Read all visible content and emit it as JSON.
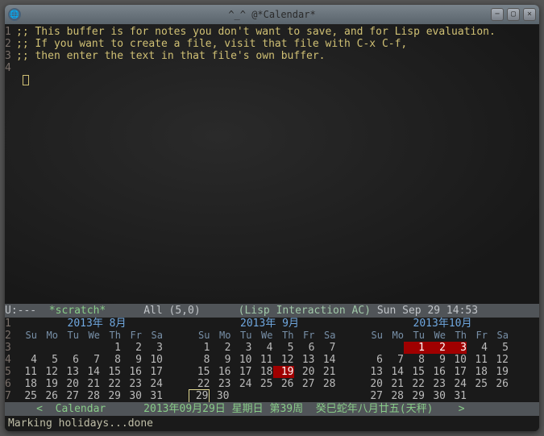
{
  "titlebar": {
    "title": "^_^ @*Calendar*",
    "minimize": "−",
    "maximize": "▢",
    "close": "×"
  },
  "scratch": {
    "lines": [
      ";; This buffer is for notes you don't want to save, and for Lisp evaluation.",
      ";; If you want to create a file, visit that file with C-x C-f,",
      ";; then enter the text in that file's own buffer.",
      ""
    ]
  },
  "modeline_top": {
    "left": "U:---  ",
    "bufname": "*scratch*",
    "mid": "      All (5,0)      ",
    "mode": "(Lisp Interaction AC)",
    "right": " Sun Sep 29 14:53"
  },
  "calendar": {
    "line_start": 1,
    "day_headers": [
      "Su",
      "Mo",
      "Tu",
      "We",
      "Th",
      "Fr",
      "Sa"
    ],
    "months": [
      {
        "title": "2013年 8月",
        "weeks": [
          [
            null,
            null,
            null,
            null,
            1,
            2,
            3
          ],
          [
            4,
            5,
            6,
            7,
            8,
            9,
            10
          ],
          [
            11,
            12,
            13,
            14,
            15,
            16,
            17
          ],
          [
            18,
            19,
            20,
            21,
            22,
            23,
            24
          ],
          [
            25,
            26,
            27,
            28,
            29,
            30,
            31
          ]
        ],
        "holidays": [],
        "today": null,
        "cursor": null
      },
      {
        "title": "2013年 9月",
        "weeks": [
          [
            1,
            2,
            3,
            4,
            5,
            6,
            7
          ],
          [
            8,
            9,
            10,
            11,
            12,
            13,
            14
          ],
          [
            15,
            16,
            17,
            18,
            19,
            20,
            21
          ],
          [
            22,
            23,
            24,
            25,
            26,
            27,
            28
          ],
          [
            29,
            30,
            null,
            null,
            null,
            null,
            null
          ]
        ],
        "holidays": [
          19
        ],
        "today": null,
        "cursor": 29
      },
      {
        "title": "2013年10月",
        "weeks": [
          [
            null,
            null,
            1,
            2,
            3,
            4,
            5
          ],
          [
            6,
            7,
            8,
            9,
            10,
            11,
            12
          ],
          [
            13,
            14,
            15,
            16,
            17,
            18,
            19
          ],
          [
            20,
            21,
            22,
            23,
            24,
            25,
            26
          ],
          [
            27,
            28,
            29,
            30,
            31,
            null,
            null
          ]
        ],
        "holidays": [
          1,
          2,
          3
        ],
        "today": null,
        "cursor": null
      }
    ]
  },
  "modeline_bottom": {
    "text": "     <  Calendar      2013年09月29日 星期日 第39周  癸巳蛇年八月廿五(天秤)    >"
  },
  "echo_area": {
    "text": "Marking holidays...done"
  }
}
